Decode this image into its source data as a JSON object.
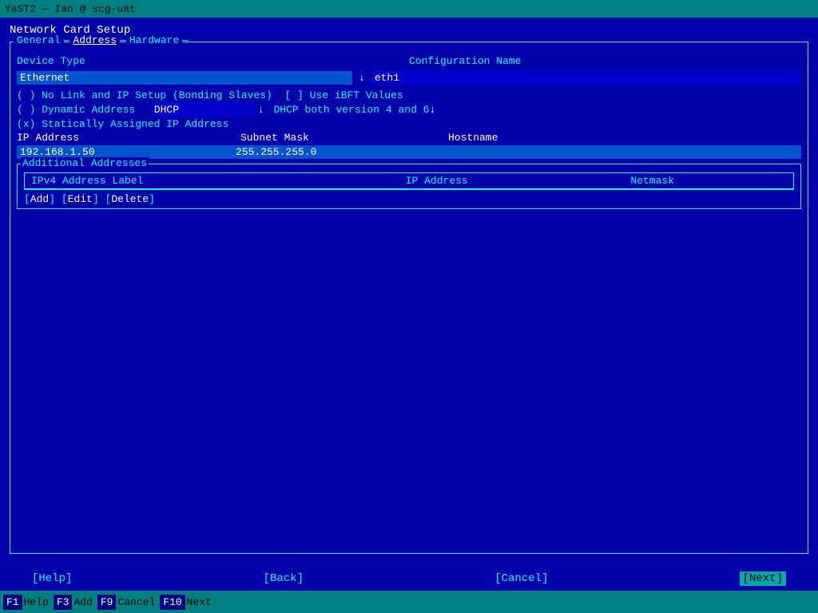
{
  "titlebar": {
    "text": "YaST2 — Ian @ scg-uat"
  },
  "page_title": "Network Card Setup",
  "tabs": [
    {
      "label": "General",
      "active": false
    },
    {
      "label": "Address",
      "active": true
    },
    {
      "label": "Hardware",
      "active": false
    }
  ],
  "form": {
    "device_type_label": "Device Type",
    "config_name_label": "Configuration Name",
    "device_type_value": "Ethernet",
    "config_name_value": "eth1",
    "radio_no_link": "( ) No Link and IP Setup (Bonding Slaves)",
    "check_ibft": "[ ] Use iBFT Values",
    "radio_dynamic": "( ) Dynamic Address",
    "dhcp_value": "DHCP",
    "dhcp_desc": "DHCP both version 4 and 6",
    "radio_static": "(x) Statically Assigned IP Address",
    "ip_address_label": "IP Address",
    "subnet_mask_label": "Subnet Mask",
    "hostname_label": "Hostname",
    "ip_address_value": "192.168.1.50",
    "subnet_mask_value": "255.255.255.0",
    "hostname_value": ""
  },
  "additional_addresses": {
    "legend": "Additional Addresses",
    "columns": [
      "IPv4 Address Label",
      "IP Address",
      "Netmask"
    ],
    "rows": [],
    "buttons": {
      "add": "[Add]",
      "edit": "[Edit]",
      "delete": "[Delete]"
    }
  },
  "nav": {
    "help_label": "[Help]",
    "back_label": "[Back]",
    "cancel_label": "[Cancel]",
    "next_label": "[Next]"
  },
  "fkeys": [
    {
      "key": "F1",
      "label": "Help"
    },
    {
      "key": "F3",
      "label": "Add"
    },
    {
      "key": "F9",
      "label": "Cancel"
    },
    {
      "key": "F10",
      "label": "Next"
    }
  ]
}
